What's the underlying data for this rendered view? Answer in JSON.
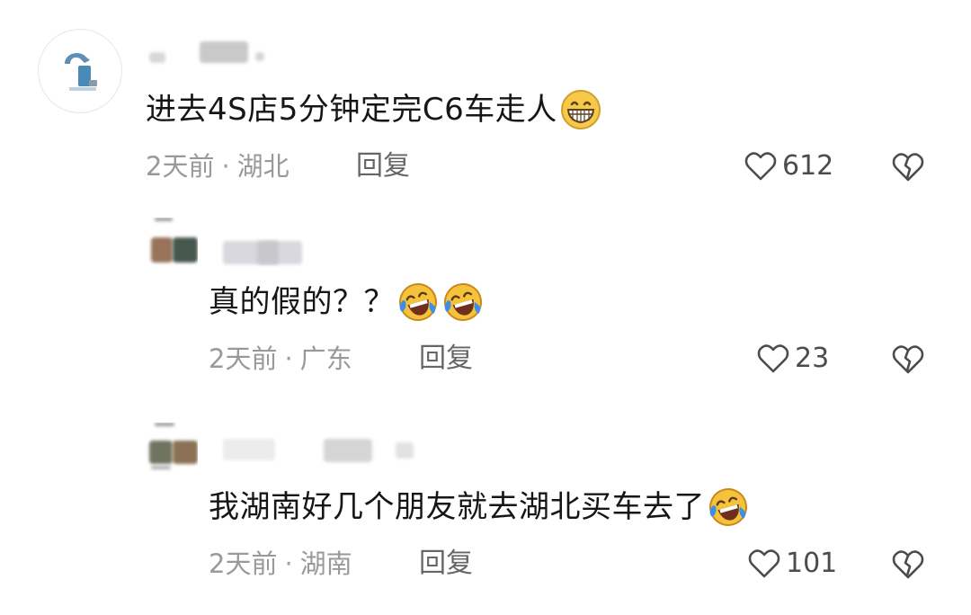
{
  "comments": [
    {
      "text": "进去4S店5分钟定完C6车走人",
      "emojis": [
        "grin-emoji"
      ],
      "time": "2天前",
      "location": "湖北",
      "reply_label": "回复",
      "likes": "612",
      "avatar_type": "profile-avatar"
    },
    {
      "text": "真的假的？？",
      "emojis": [
        "laughing-tears-emoji",
        "laughing-tears-emoji"
      ],
      "time": "2天前",
      "location": "广东",
      "reply_label": "回复",
      "likes": "23",
      "avatar_type": "blurred-avatar"
    },
    {
      "text": "我湖南好几个朋友就去湖北买车去了",
      "emojis": [
        "laughing-tears-emoji"
      ],
      "time": "2天前",
      "location": "湖南",
      "reply_label": "回复",
      "likes": "101",
      "avatar_type": "blurred-avatar"
    }
  ],
  "icons": {
    "like": "heart-icon",
    "dislike": "broken-heart-icon"
  },
  "colors": {
    "text": "#161616",
    "meta": "#999999",
    "reply": "#666666",
    "icon": "#4c4c4c"
  }
}
